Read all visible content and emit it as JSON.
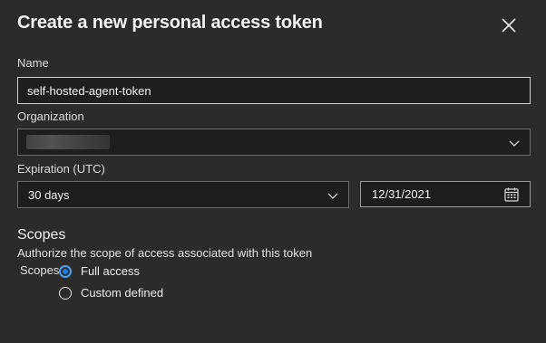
{
  "dialog": {
    "title": "Create a new personal access token",
    "close_icon": "close-icon"
  },
  "name_field": {
    "label": "Name",
    "value": "self-hosted-agent-token"
  },
  "organization_field": {
    "label": "Organization",
    "value": "",
    "redacted": true,
    "icon": "chevron-down-icon"
  },
  "expiration": {
    "label": "Expiration (UTC)",
    "selected": "30 days",
    "date_value": "12/31/2021",
    "dropdown_icon": "chevron-down-icon",
    "date_icon": "calendar-icon"
  },
  "scopes": {
    "heading": "Scopes",
    "description": "Authorize the scope of access associated with this token",
    "label": "Scopes",
    "options": [
      {
        "label": "Full access",
        "checked": true
      },
      {
        "label": "Custom defined",
        "checked": false
      }
    ]
  },
  "colors": {
    "background": "#2c2b2a",
    "input_bg": "#1f1e1d",
    "radio_accent": "#4ea1f5"
  }
}
